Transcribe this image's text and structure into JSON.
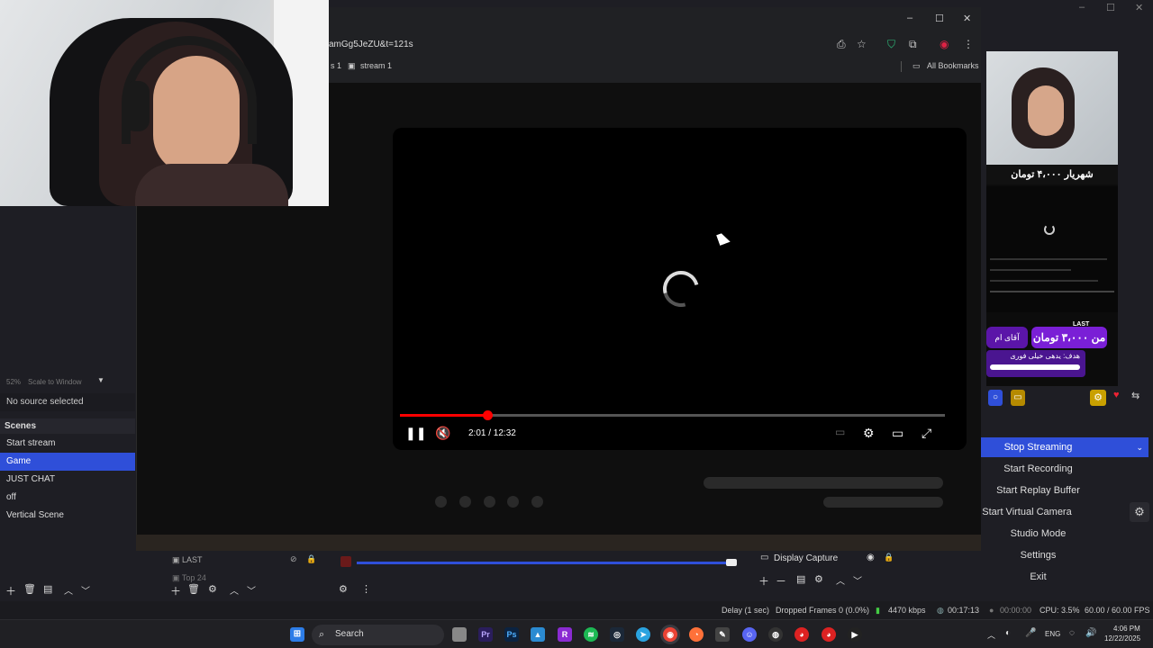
{
  "browser": {
    "url_fragment": "amGg5JeZU&t=121s",
    "bookmarks": [
      {
        "label": "s 1"
      },
      {
        "label": "stream 1"
      }
    ],
    "all_bookmarks": "All Bookmarks",
    "window_controls": [
      "–",
      "☐",
      "✕"
    ]
  },
  "video": {
    "time": "2:01 / 12:32",
    "progress_fraction": 0.16
  },
  "obs": {
    "zoom": "52%",
    "scale_mode": "Scale to Window",
    "no_source": "No source selected",
    "scenes_header": "Scenes",
    "scenes": [
      {
        "label": "Start stream",
        "selected": false
      },
      {
        "label": "Game",
        "selected": true
      },
      {
        "label": "JUST CHAT",
        "selected": false
      },
      {
        "label": "off",
        "selected": false
      },
      {
        "label": "Vertical Scene",
        "selected": false
      }
    ],
    "sources": [
      {
        "label": "LAST"
      },
      {
        "label": "Top 24"
      }
    ],
    "display_capture": "Display Capture",
    "controls": [
      {
        "label": "Stop Streaming",
        "active": true
      },
      {
        "label": "Start Recording",
        "active": false
      },
      {
        "label": "Start Replay Buffer",
        "active": false
      },
      {
        "label": "Start Virtual Camera",
        "active": false
      },
      {
        "label": "Studio Mode",
        "active": false
      },
      {
        "label": "Settings",
        "active": false
      },
      {
        "label": "Exit",
        "active": false
      }
    ],
    "status": {
      "delay": "Delay (1 sec)",
      "dropped": "Dropped Frames 0 (0.0%)",
      "bitrate": "4470 kbps",
      "stream_time": "00:17:13",
      "rec_time": "00:00:00",
      "cpu": "CPU: 3.5%",
      "fps": "60.00 / 60.00 FPS"
    },
    "preview": {
      "donation_top": "شهریار ۴،۰۰۰ تومان",
      "donation_main": "من ۳،۰۰۰ تومان",
      "donation_side": "آقای ام",
      "last_label": "LAST",
      "goal_label": "هدف: یدهی خیلی فوری"
    }
  },
  "taskbar": {
    "search_placeholder": "Search",
    "lang": "ENG",
    "time": "4:06 PM",
    "date": "12/22/2025"
  },
  "colors": {
    "accent": "#2f4fd9",
    "progress": "#ff0000",
    "purple": "#7a1fd6"
  }
}
